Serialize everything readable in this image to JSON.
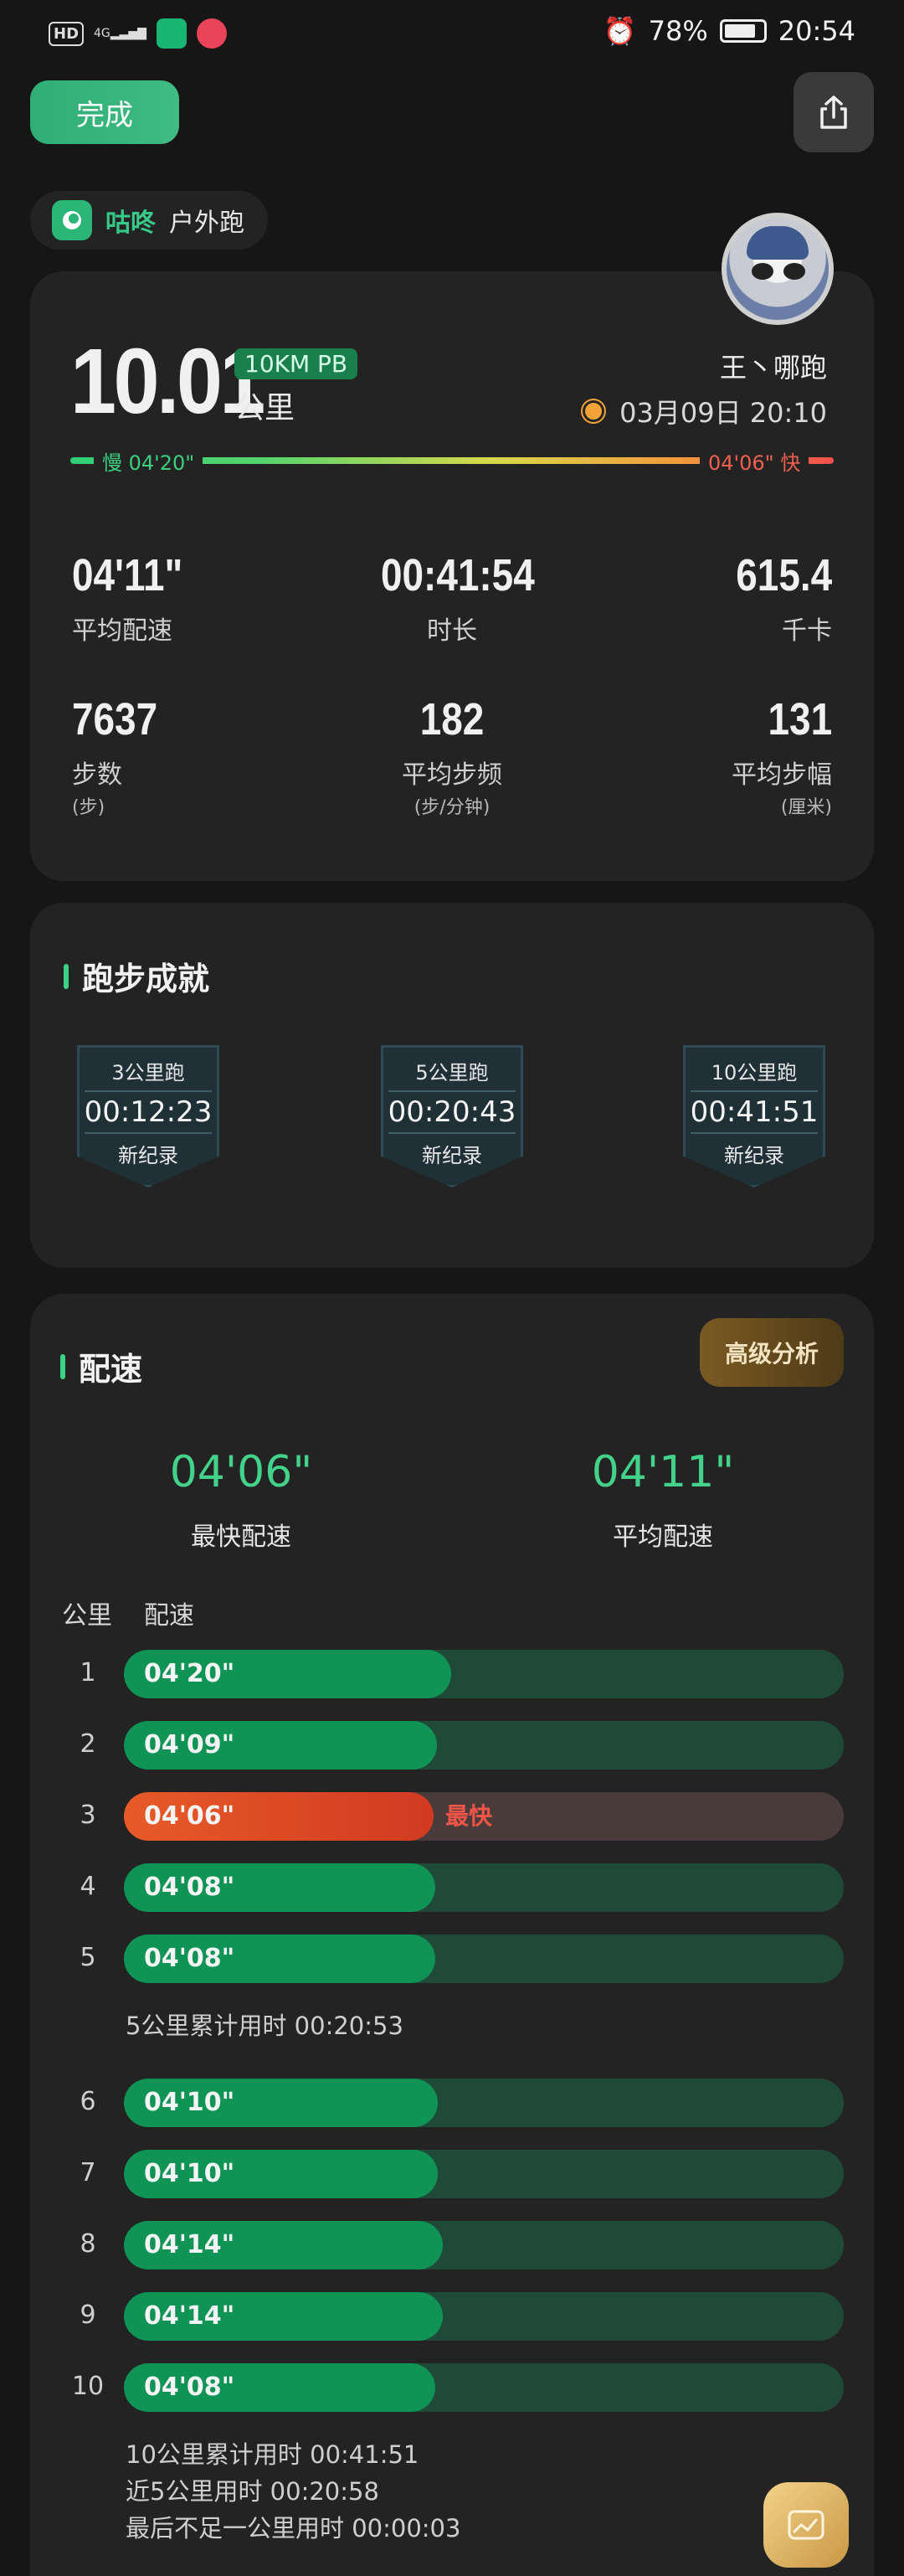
{
  "status_bar": {
    "hd": "HD",
    "signal": "4G",
    "battery": "78%",
    "time": "20:54"
  },
  "header": {
    "done_label": "完成"
  },
  "tag": {
    "brand": "咕咚",
    "type": "户外跑"
  },
  "summary": {
    "distance": "10.01",
    "pb_badge": "10KM PB",
    "unit": "公里",
    "user": "王丶哪跑",
    "date": "03月09日 20:10",
    "pace_slow": "慢 04'20\"",
    "pace_fast": "04'06\" 快",
    "stats": [
      {
        "value": "04'11\"",
        "label": "平均配速",
        "sub": ""
      },
      {
        "value": "00:41:54",
        "label": "时长",
        "sub": ""
      },
      {
        "value": "615.4",
        "label": "千卡",
        "sub": ""
      },
      {
        "value": "7637",
        "label": "步数",
        "sub": "(步)"
      },
      {
        "value": "182",
        "label": "平均步频",
        "sub": "(步/分钟)"
      },
      {
        "value": "131",
        "label": "平均步幅",
        "sub": "(厘米)"
      }
    ]
  },
  "achievements": {
    "title": "跑步成就",
    "medals": [
      {
        "name": "3公里跑",
        "time": "00:12:23",
        "record": "新纪录"
      },
      {
        "name": "5公里跑",
        "time": "00:20:43",
        "record": "新纪录"
      },
      {
        "name": "10公里跑",
        "time": "00:41:51",
        "record": "新纪录"
      }
    ]
  },
  "pace": {
    "title": "配速",
    "advanced_label": "高级分析",
    "fastest_value": "04'06\"",
    "fastest_label": "最快配速",
    "average_value": "04'11\"",
    "average_label": "平均配速",
    "col_km": "公里",
    "col_pace": "配速",
    "fastest_tag": "最快",
    "splits": [
      {
        "km": "1",
        "pace": "04'20\"",
        "fill": 0.455,
        "fastest": false
      },
      {
        "km": "2",
        "pace": "04'09\"",
        "fill": 0.435,
        "fastest": false
      },
      {
        "km": "3",
        "pace": "04'06\"",
        "fill": 0.43,
        "fastest": true
      },
      {
        "km": "4",
        "pace": "04'08\"",
        "fill": 0.433,
        "fastest": false
      },
      {
        "km": "5",
        "pace": "04'08\"",
        "fill": 0.433,
        "fastest": false
      },
      {
        "km": "6",
        "pace": "04'10\"",
        "fill": 0.436,
        "fastest": false
      },
      {
        "km": "7",
        "pace": "04'10\"",
        "fill": 0.436,
        "fastest": false
      },
      {
        "km": "8",
        "pace": "04'14\"",
        "fill": 0.443,
        "fastest": false
      },
      {
        "km": "9",
        "pace": "04'14\"",
        "fill": 0.443,
        "fastest": false
      },
      {
        "km": "10",
        "pace": "04'08\"",
        "fill": 0.433,
        "fastest": false
      }
    ],
    "note_5km": "5公里累计用时 00:20:53",
    "note_10km": "10公里累计用时 00:41:51",
    "note_last5": "近5公里用时 00:20:58",
    "note_remainder": "最后不足一公里用时 00:00:03"
  }
}
